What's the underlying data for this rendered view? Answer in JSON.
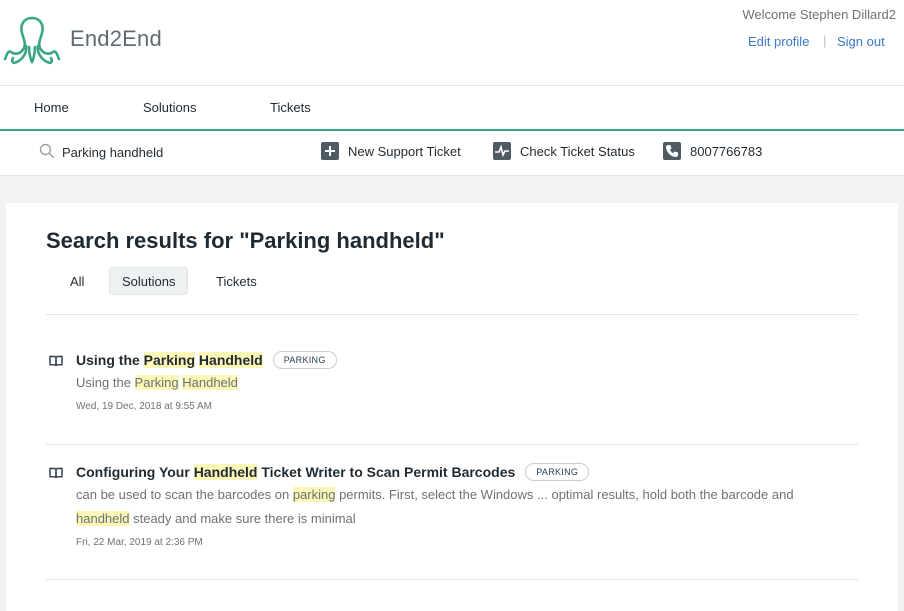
{
  "header": {
    "brand": "End2End",
    "welcome": "Welcome Stephen Dillard2",
    "edit_profile": "Edit profile",
    "separator": "|",
    "sign_out": "Sign out"
  },
  "nav": {
    "items": [
      {
        "label": "Home"
      },
      {
        "label": "Solutions"
      },
      {
        "label": "Tickets"
      }
    ]
  },
  "toolbar": {
    "search_value": "Parking handheld",
    "new_ticket": "New Support Ticket",
    "check_status": "Check Ticket Status",
    "phone": "8007766783"
  },
  "main": {
    "title": "Search results for \"Parking handheld\"",
    "tabs": [
      {
        "label": "All",
        "active": false
      },
      {
        "label": "Solutions",
        "active": true
      },
      {
        "label": "Tickets",
        "active": false
      }
    ],
    "results": [
      {
        "title_parts": [
          "Using the ",
          "Parking",
          " ",
          "Handheld"
        ],
        "badge": "PARKING",
        "desc_parts": [
          "Using the ",
          "Parking",
          " ",
          "Handheld"
        ],
        "date": "Wed, 19 Dec, 2018 at 9:55 AM"
      },
      {
        "title_parts": [
          "Configuring Your ",
          "Handheld",
          " Ticket Writer to Scan Permit Barcodes"
        ],
        "badge": "PARKING",
        "desc_line1_parts": [
          "can be used to scan the barcodes on ",
          "parking",
          " permits. First, select the Windows ... optimal results, hold both the barcode and"
        ],
        "desc_line2_parts": [
          "handheld",
          " steady and make sure there is minimal"
        ],
        "date": "Fri, 22 Mar, 2019 at 2:36 PM"
      }
    ]
  },
  "colors": {
    "accent": "#3aa782",
    "link": "#3b78c4",
    "highlight": "#fcf7b6"
  }
}
